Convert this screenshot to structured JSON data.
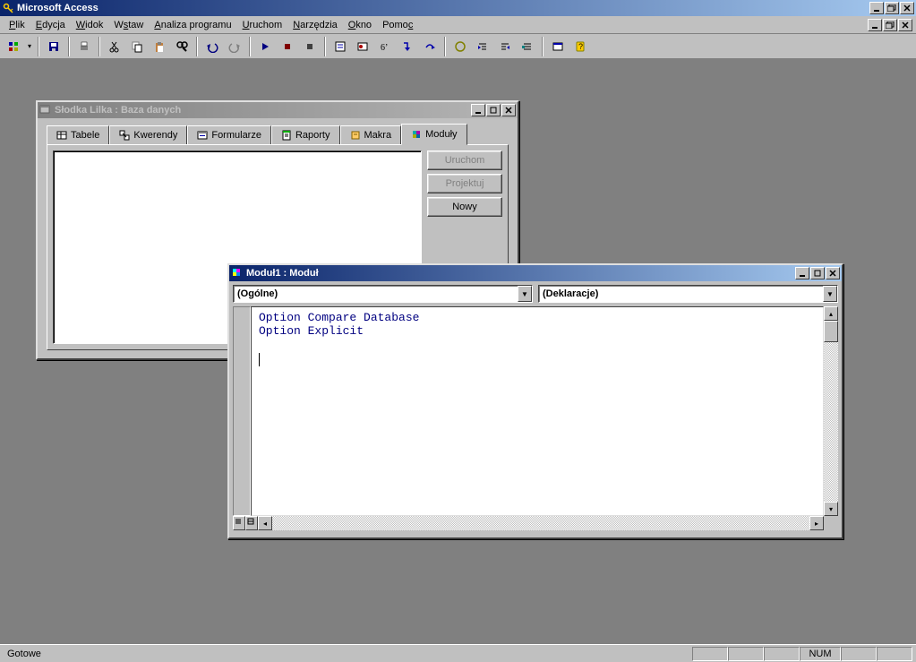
{
  "app": {
    "title": "Microsoft Access"
  },
  "menu": {
    "items": [
      "Plik",
      "Edycja",
      "Widok",
      "Wstaw",
      "Analiza programu",
      "Uruchom",
      "Narzędzia",
      "Okno",
      "Pomoc"
    ]
  },
  "db_window": {
    "title": "Słodka Lilka : Baza danych",
    "tabs": [
      "Tabele",
      "Kwerendy",
      "Formularze",
      "Raporty",
      "Makra",
      "Moduły"
    ],
    "active_tab": "Moduły",
    "actions": {
      "run": "Uruchom",
      "design": "Projektuj",
      "new": "Nowy"
    }
  },
  "mod_window": {
    "title": "Moduł1 : Moduł",
    "combo_left": "(Ogólne)",
    "combo_right": "(Deklaracje)",
    "code_line1": "Option Compare Database",
    "code_line2": "Option Explicit"
  },
  "status": {
    "text": "Gotowe",
    "num": "NUM"
  }
}
